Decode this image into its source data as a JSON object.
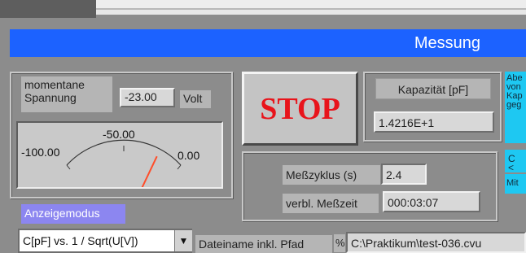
{
  "header": {
    "title": "Messung"
  },
  "voltage": {
    "label": "momentane Spannung",
    "value": "-23.00",
    "unit": "Volt"
  },
  "gauge": {
    "min_label": "-100.00",
    "mid_label": "-50.00",
    "max_label": "0.00",
    "min": -100,
    "max": 0,
    "value": -23.0,
    "needle_color": "#ff4d2a"
  },
  "stop_button": {
    "label": "STOP"
  },
  "capacitance": {
    "label": "Kapazität [pF]",
    "value": "1.4216E+1"
  },
  "cycle": {
    "label": "Meßzyklus (s)",
    "value": "2.4"
  },
  "remaining": {
    "label": "verbl. Meßzeit",
    "value": "000:03:07"
  },
  "side_panel": {
    "fragment_1": "Abe von Kap geg",
    "fragment_2": "C <",
    "fragment_3": "Mit"
  },
  "display_mode": {
    "label": "Anzeigemodus",
    "selected": "C[pF] vs. 1 / Sqrt(U[V])"
  },
  "file": {
    "label": "Dateiname inkl. Pfad",
    "prefix": "%",
    "path": "C:\\Praktikum\\test-036.cvu"
  },
  "colors": {
    "title_bar": "#1c62ff",
    "stop_text": "#e8141b",
    "mode_label": "#8c86f0",
    "side_panel": "#1ec8f2"
  }
}
